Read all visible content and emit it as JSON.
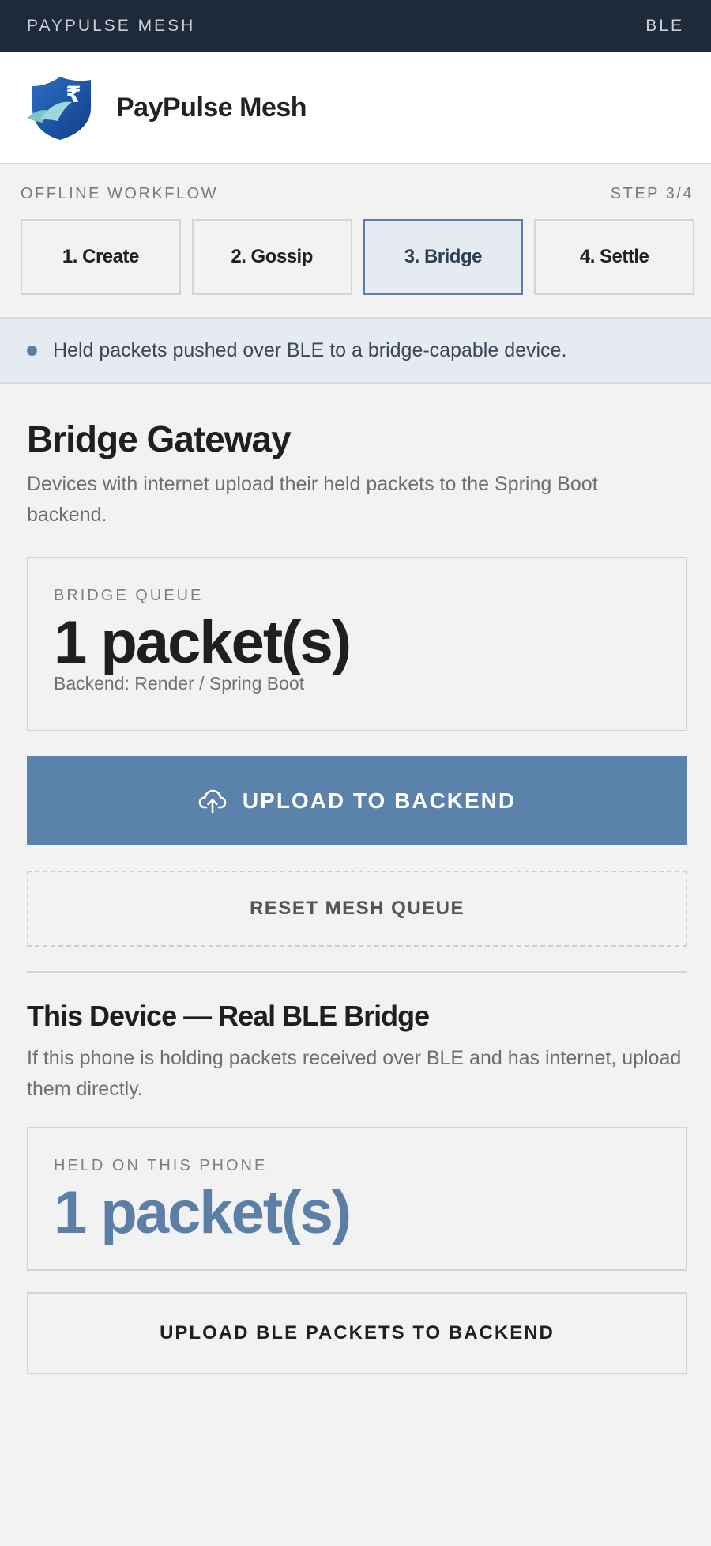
{
  "status_bar": {
    "left": "PAYPULSE MESH",
    "right": "BLE"
  },
  "header": {
    "title": "PayPulse Mesh",
    "logo_icon": "shield-rupee-icon"
  },
  "workflow": {
    "label": "OFFLINE WORKFLOW",
    "step_indicator": "STEP 3/4",
    "steps": [
      {
        "label": "1. Create"
      },
      {
        "label": "2. Gossip"
      },
      {
        "label": "3. Bridge"
      },
      {
        "label": "4. Settle"
      }
    ],
    "active_step": 2
  },
  "banner": {
    "text": "Held packets pushed over BLE to a bridge-capable device."
  },
  "gateway": {
    "title": "Bridge Gateway",
    "description": "Devices with internet upload their held packets to the Spring Boot backend.",
    "queue_label": "BRIDGE QUEUE",
    "queue_value": "1 packet(s)",
    "backend_text": "Backend: Render / Spring Boot",
    "upload_label": "UPLOAD TO BACKEND",
    "upload_icon": "cloud-upload-icon",
    "reset_label": "RESET MESH QUEUE"
  },
  "device": {
    "title": "This Device — Real BLE Bridge",
    "description": "If this phone is holding packets received over BLE and has internet, upload them directly.",
    "held_label": "HELD ON THIS PHONE",
    "held_value": "1 packet(s)",
    "upload_label": "UPLOAD BLE PACKETS TO BACKEND"
  },
  "colors": {
    "status_bar_bg": "#1e2a3a",
    "accent": "#5b7fa6",
    "primary_button": "#5b82aa",
    "background": "#f2f2f2"
  }
}
